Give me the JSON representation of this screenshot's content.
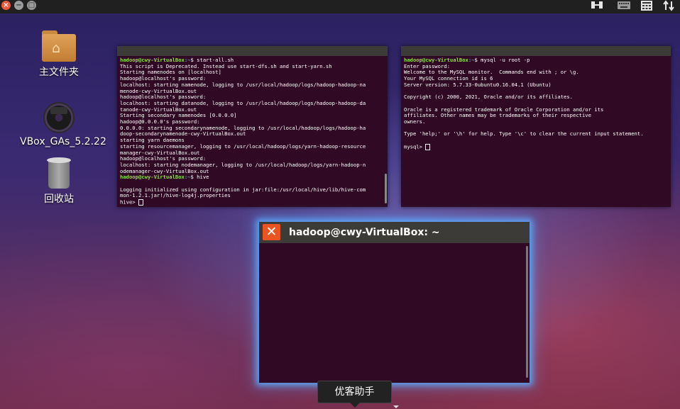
{
  "top_panel": {
    "close_glyph": "×",
    "min_glyph": "−",
    "max_glyph": "□",
    "tray_icons": [
      "network-icon",
      "keyboard-icon",
      "calculator-icon",
      "transfer-arrows-icon"
    ]
  },
  "desktop": {
    "icons": [
      {
        "label": "主文件夹",
        "icon": "home-folder-icon"
      },
      {
        "label": "VBox_GAs_5.2.22",
        "icon": "cd-disc-icon"
      },
      {
        "label": "回收站",
        "icon": "trash-icon"
      }
    ]
  },
  "terminal_left": {
    "lines": [
      {
        "user": "hadoop@cwy-VirtualBox",
        "path": ":~",
        "cmd": "$ start-all.sh"
      },
      {
        "text": "This script is Deprecated. Instead use start-dfs.sh and start-yarn.sh"
      },
      {
        "text": "Starting namenodes on [localhost]"
      },
      {
        "text": "hadoop@localhost's password:"
      },
      {
        "text": "localhost: starting namenode, logging to /usr/local/hadoop/logs/hadoop-hadoop-na"
      },
      {
        "text": "menode-cwy-VirtualBox.out"
      },
      {
        "text": "hadoop@localhost's password:"
      },
      {
        "text": "localhost: starting datanode, logging to /usr/local/hadoop/logs/hadoop-hadoop-da"
      },
      {
        "text": "tanode-cwy-VirtualBox.out"
      },
      {
        "text": "Starting secondary namenodes [0.0.0.0]"
      },
      {
        "text": "hadoop@0.0.0.0's password:"
      },
      {
        "text": "0.0.0.0: starting secondarynamenode, logging to /usr/local/hadoop/logs/hadoop-ha"
      },
      {
        "text": "doop-secondarynamenode-cwy-VirtualBox.out"
      },
      {
        "text": "starting yarn daemons"
      },
      {
        "text": "starting resourcemanager, logging to /usr/local/hadoop/logs/yarn-hadoop-resource"
      },
      {
        "text": "manager-cwy-VirtualBox.out"
      },
      {
        "text": "hadoop@localhost's password:"
      },
      {
        "text": "localhost: starting nodemanager, logging to /usr/local/hadoop/logs/yarn-hadoop-n"
      },
      {
        "text": "odemanager-cwy-VirtualBox.out"
      },
      {
        "user": "hadoop@cwy-VirtualBox",
        "path": ":~",
        "cmd": "$ hive"
      },
      {
        "text": ""
      },
      {
        "text": "Logging initialized using configuration in jar:file:/usr/local/hive/lib/hive-com"
      },
      {
        "text": "mon-1.2.1.jar!/hive-log4j.properties"
      },
      {
        "text": "hive> ",
        "cursor": true
      }
    ]
  },
  "terminal_right": {
    "lines": [
      {
        "user": "hadoop@cwy-VirtualBox",
        "path": ":~",
        "cmd": "$ mysql -u root -p"
      },
      {
        "text": "Enter password:"
      },
      {
        "text": "Welcome to the MySQL monitor.  Commands end with ; or \\g."
      },
      {
        "text": "Your MySQL connection id is 6"
      },
      {
        "text": "Server version: 5.7.33-0ubuntu0.16.04.1 (Ubuntu)"
      },
      {
        "text": ""
      },
      {
        "text": "Copyright (c) 2000, 2021, Oracle and/or its affiliates."
      },
      {
        "text": ""
      },
      {
        "text": "Oracle is a registered trademark of Oracle Corporation and/or its"
      },
      {
        "text": "affiliates. Other names may be trademarks of their respective"
      },
      {
        "text": "owners."
      },
      {
        "text": ""
      },
      {
        "text": "Type 'help;' or '\\h' for help. Type '\\c' to clear the current input statement."
      },
      {
        "text": ""
      },
      {
        "text": "mysql> ",
        "cursor": true
      }
    ]
  },
  "focused_window": {
    "close_glyph": "✕",
    "title": "hadoop@cwy-VirtualBox: ~"
  },
  "tooltip": {
    "text": "优客助手"
  }
}
